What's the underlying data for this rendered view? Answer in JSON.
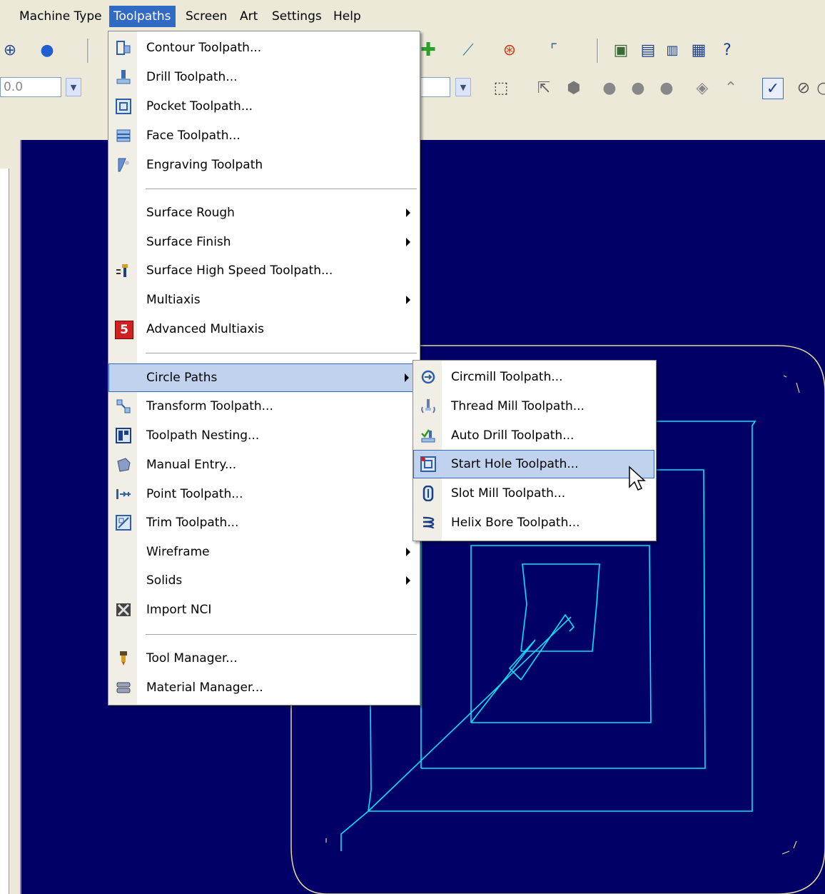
{
  "menubar": {
    "items": [
      "Machine Type",
      "Toolpaths",
      "Screen",
      "Art",
      "Settings",
      "Help"
    ]
  },
  "toolbar2": {
    "numeric_value": "0.0"
  },
  "toolpaths_menu": {
    "items": [
      {
        "label": "Contour Toolpath...",
        "icon": "contour-icon"
      },
      {
        "label": "Drill Toolpath...",
        "icon": "drill-icon"
      },
      {
        "label": "Pocket Toolpath...",
        "icon": "pocket-icon"
      },
      {
        "label": "Face Toolpath...",
        "icon": "face-icon"
      },
      {
        "label": "Engraving Toolpath",
        "icon": "engraving-icon"
      },
      {
        "label": "Surface Rough",
        "submenu": true
      },
      {
        "label": "Surface Finish",
        "submenu": true
      },
      {
        "label": "Surface High Speed Toolpath...",
        "icon": "high-speed-icon"
      },
      {
        "label": "Multiaxis",
        "submenu": true
      },
      {
        "label": "Advanced Multiaxis",
        "icon": "five-axis-icon",
        "icon_text": "5"
      },
      {
        "label": "Circle Paths",
        "submenu": true,
        "highlighted": true
      },
      {
        "label": "Transform Toolpath...",
        "icon": "transform-icon"
      },
      {
        "label": "Toolpath Nesting...",
        "icon": "nesting-icon"
      },
      {
        "label": "Manual Entry...",
        "icon": "manual-entry-icon"
      },
      {
        "label": "Point Toolpath...",
        "icon": "point-icon"
      },
      {
        "label": "Trim Toolpath...",
        "icon": "trim-icon"
      },
      {
        "label": "Wireframe",
        "submenu": true
      },
      {
        "label": "Solids",
        "submenu": true
      },
      {
        "label": "Import NCI",
        "icon": "import-nci-icon"
      },
      {
        "label": "Tool Manager...",
        "icon": "tool-manager-icon"
      },
      {
        "label": "Material Manager...",
        "icon": "material-manager-icon"
      }
    ]
  },
  "circle_paths_submenu": {
    "items": [
      {
        "label": "Circmill Toolpath...",
        "icon": "circmill-icon"
      },
      {
        "label": "Thread Mill Toolpath...",
        "icon": "thread-mill-icon"
      },
      {
        "label": "Auto Drill Toolpath...",
        "icon": "auto-drill-icon"
      },
      {
        "label": "Start Hole Toolpath...",
        "icon": "start-hole-icon",
        "highlighted": true
      },
      {
        "label": "Slot Mill Toolpath...",
        "icon": "slot-mill-icon"
      },
      {
        "label": "Helix Bore Toolpath...",
        "icon": "helix-bore-icon"
      }
    ]
  },
  "colors": {
    "canvas_bg": "#000066",
    "toolpath": "#00e5ff",
    "boundary": "#e6d7a0",
    "menu_highlight": "#c1d2ee",
    "menubar_active": "#316ac5"
  }
}
